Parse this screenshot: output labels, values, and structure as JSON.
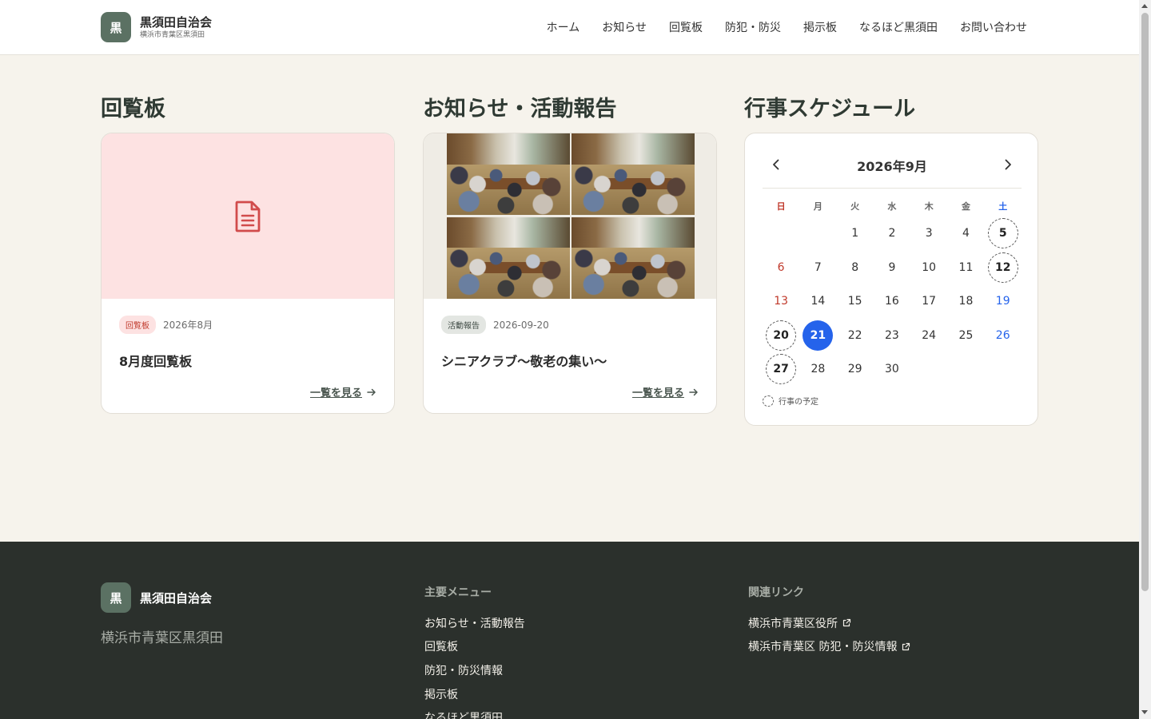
{
  "header": {
    "logo_char": "黒",
    "site_title": "黒須田自治会",
    "site_subtitle": "横浜市青葉区黒須田",
    "nav": [
      {
        "label": "ホーム"
      },
      {
        "label": "お知らせ"
      },
      {
        "label": "回覧板"
      },
      {
        "label": "防犯・防災"
      },
      {
        "label": "掲示板"
      },
      {
        "label": "なるほど黒須田"
      },
      {
        "label": "お問い合わせ"
      }
    ]
  },
  "sections": {
    "circular_title": "回覧板",
    "news_title": "お知らせ・活動報告",
    "schedule_title": "行事スケジュール"
  },
  "circular_card": {
    "tag": "回覧板",
    "date": "2026年8月",
    "title": "8月度回覧板",
    "more_label": "一覧を見る",
    "icon": "document-icon",
    "tag_color": "#c0392b"
  },
  "news_card": {
    "tag": "活動報告",
    "date": "2026-09-20",
    "title": "シニアクラブ～敬老の集い～",
    "more_label": "一覧を見る"
  },
  "calendar": {
    "month_label": "2026年9月",
    "weekdays": [
      "日",
      "月",
      "火",
      "水",
      "木",
      "金",
      "土"
    ],
    "first_weekday_index": 2,
    "days": [
      "1",
      "2",
      "3",
      "4",
      "5",
      "6",
      "7",
      "8",
      "9",
      "10",
      "11",
      "12",
      "13",
      "14",
      "15",
      "16",
      "17",
      "18",
      "19",
      "20",
      "21",
      "22",
      "23",
      "24",
      "25",
      "26",
      "27",
      "28",
      "29",
      "30"
    ],
    "event_days": [
      5,
      12,
      20,
      27
    ],
    "today": 21,
    "legend_label": "行事の予定",
    "today_color": "#2563eb",
    "sunday_color": "#c0392b",
    "saturday_color": "#2563eb"
  },
  "footer": {
    "logo_char": "黒",
    "site_title": "黒須田自治会",
    "address": "横浜市青葉区黒須田",
    "menu_heading": "主要メニュー",
    "menu": [
      {
        "label": "お知らせ・活動報告"
      },
      {
        "label": "回覧板"
      },
      {
        "label": "防犯・防災情報"
      },
      {
        "label": "掲示板"
      },
      {
        "label": "なるほど黒須田"
      }
    ],
    "links_heading": "関連リンク",
    "links": [
      {
        "label": "横浜市青葉区役所"
      },
      {
        "label": "横浜市青葉区 防犯・防災情報"
      }
    ],
    "background": "#2b302c"
  }
}
